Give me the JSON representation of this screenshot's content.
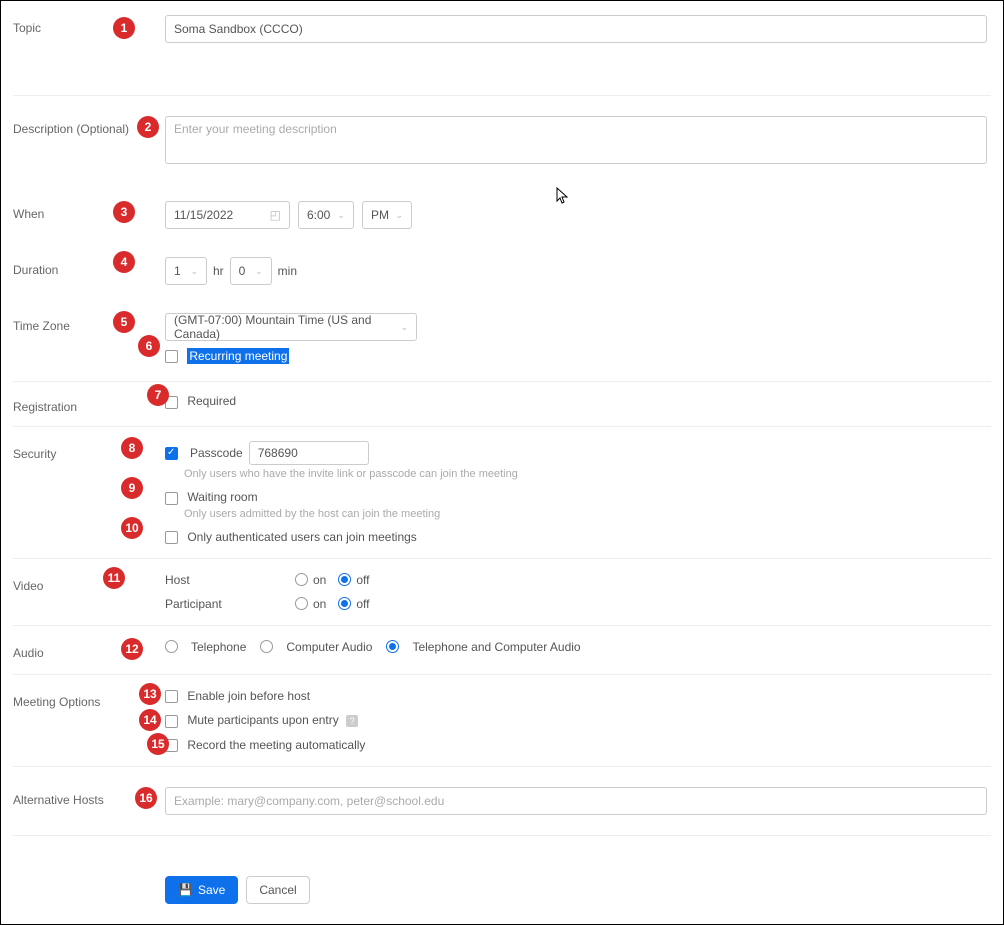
{
  "markers": [
    "1",
    "2",
    "3",
    "4",
    "5",
    "6",
    "7",
    "8",
    "9",
    "10",
    "11",
    "12",
    "13",
    "14",
    "15",
    "16"
  ],
  "labels": {
    "topic": "Topic",
    "description": "Description (Optional)",
    "when": "When",
    "duration": "Duration",
    "timezone": "Time Zone",
    "registration": "Registration",
    "security": "Security",
    "video": "Video",
    "audio": "Audio",
    "meeting_options": "Meeting Options",
    "alt_hosts": "Alternative Hosts"
  },
  "topic": {
    "value": "Soma Sandbox (CCCO)"
  },
  "description": {
    "placeholder": "Enter your meeting description"
  },
  "when": {
    "date": "11/15/2022",
    "time": "6:00",
    "ampm": "PM"
  },
  "duration": {
    "hr_val": "1",
    "hr_lbl": "hr",
    "min_val": "0",
    "min_lbl": "min"
  },
  "timezone": {
    "value": "(GMT-07:00) Mountain Time (US and Canada)",
    "recurring": "Recurring meeting"
  },
  "registration": {
    "required": "Required"
  },
  "security": {
    "passcode_lbl": "Passcode",
    "passcode_val": "768690",
    "passcode_hint": "Only users who have the invite link or passcode can join the meeting",
    "waiting_lbl": "Waiting room",
    "waiting_hint": "Only users admitted by the host can join the meeting",
    "auth_lbl": "Only authenticated users can join meetings"
  },
  "video": {
    "host_lbl": "Host",
    "participant_lbl": "Participant",
    "on": "on",
    "off": "off"
  },
  "audio": {
    "telephone": "Telephone",
    "computer": "Computer Audio",
    "both": "Telephone and Computer Audio"
  },
  "options": {
    "join_before": "Enable join before host",
    "mute": "Mute participants upon entry",
    "record": "Record the meeting automatically"
  },
  "alt_hosts": {
    "placeholder": "Example: mary@company.com, peter@school.edu"
  },
  "buttons": {
    "save": "Save",
    "cancel": "Cancel"
  }
}
